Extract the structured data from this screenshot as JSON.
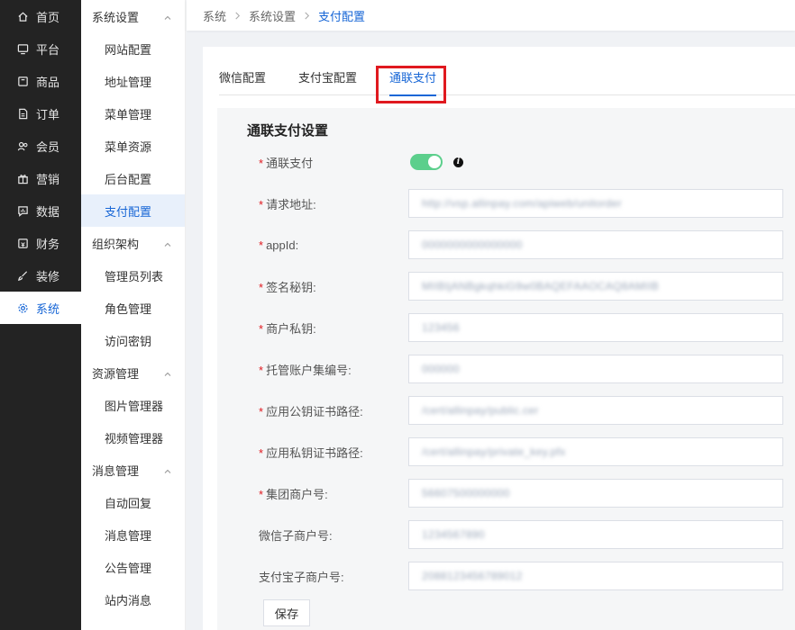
{
  "nav1": {
    "items": [
      {
        "label": "首页",
        "icon": "home-icon"
      },
      {
        "label": "平台",
        "icon": "monitor-icon"
      },
      {
        "label": "商品",
        "icon": "box-icon"
      },
      {
        "label": "订单",
        "icon": "document-icon"
      },
      {
        "label": "会员",
        "icon": "users-icon"
      },
      {
        "label": "营销",
        "icon": "gift-icon"
      },
      {
        "label": "数据",
        "icon": "chat-chart-icon"
      },
      {
        "label": "财务",
        "icon": "wallet-icon"
      },
      {
        "label": "装修",
        "icon": "brush-icon"
      },
      {
        "label": "系统",
        "icon": "gear-icon",
        "active": true
      }
    ]
  },
  "nav2": {
    "groups": [
      {
        "label": "系统设置",
        "items": [
          "网站配置",
          "地址管理",
          "菜单管理",
          "菜单资源",
          "后台配置",
          "支付配置"
        ]
      },
      {
        "label": "组织架构",
        "items": [
          "管理员列表",
          "角色管理",
          "访问密钥"
        ]
      },
      {
        "label": "资源管理",
        "items": [
          "图片管理器",
          "视频管理器"
        ]
      },
      {
        "label": "消息管理",
        "items": [
          "自动回复",
          "消息管理",
          "公告管理",
          "站内消息"
        ]
      }
    ],
    "active_item": "支付配置"
  },
  "breadcrumb": {
    "root": "系统",
    "parent": "系统设置",
    "current": "支付配置"
  },
  "tabs": {
    "items": [
      "微信配置",
      "支付宝配置",
      "通联支付"
    ],
    "active": "通联支付"
  },
  "form": {
    "title": "通联支付设置",
    "toggle": {
      "label": "通联支付",
      "enabled": true
    },
    "fields": [
      {
        "label": "请求地址:",
        "required": true,
        "value": "http://vsp.allinpay.com/apiweb/unitorder"
      },
      {
        "label": "appId:",
        "required": true,
        "value": "0000000000000000"
      },
      {
        "label": "签名秘钥:",
        "required": true,
        "value": "MIIBIjANBgkqhkiG9w0BAQEFAAOCAQ8AMIIB"
      },
      {
        "label": "商户私钥:",
        "required": true,
        "value": "123456"
      },
      {
        "label": "托管账户集编号:",
        "required": true,
        "value": "000000"
      },
      {
        "label": "应用公钥证书路径:",
        "required": true,
        "value": "/cert/allinpay/public.cer"
      },
      {
        "label": "应用私钥证书路径:",
        "required": true,
        "value": "/cert/allinpay/private_key.pfx"
      },
      {
        "label": "集团商户号:",
        "required": true,
        "value": "56607500000000"
      },
      {
        "label": "微信子商户号:",
        "required": false,
        "value": "1234567890"
      },
      {
        "label": "支付宝子商户号:",
        "required": false,
        "value": "2088123456789012"
      }
    ],
    "save_label": "保存"
  },
  "colors": {
    "accent": "#1766d6",
    "switch_on": "#5ccf8c",
    "highlight": "#e0191f",
    "nav_bg": "#232323"
  }
}
